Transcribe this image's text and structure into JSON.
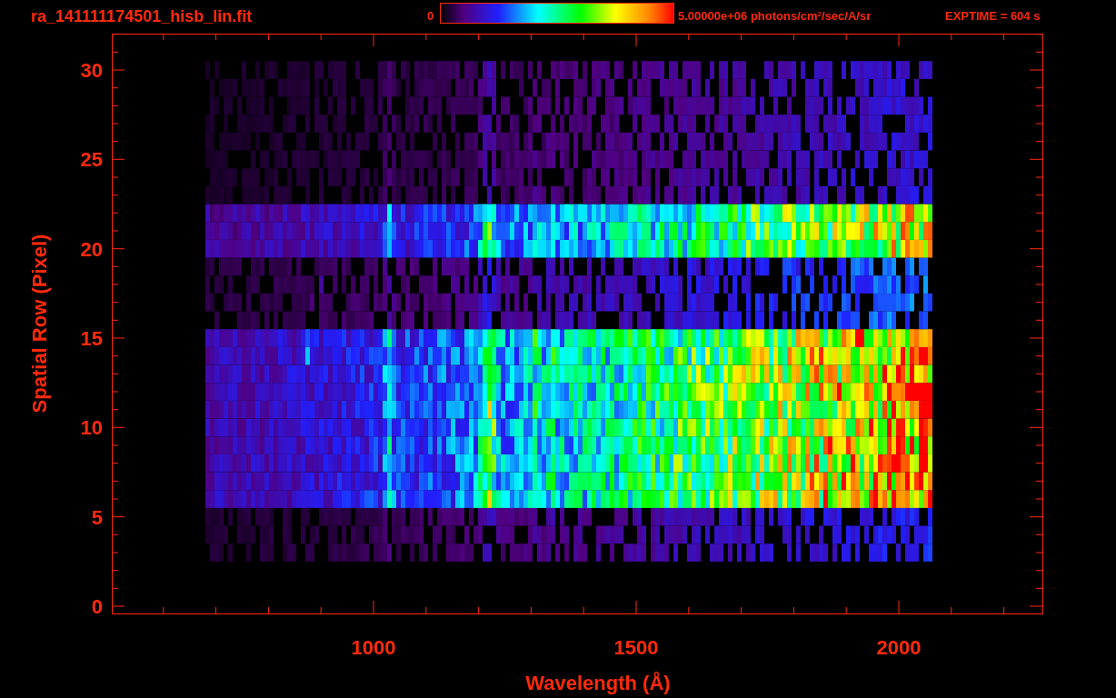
{
  "title": "ra_141111174501_hisb_lin.fit",
  "colorbar": {
    "min_label": "0",
    "max_label": "5.00000e+06 photons/cm$^{2}$/sec/A/sr"
  },
  "exposure": "EXPTIME = 604 s",
  "plot": {
    "xlabel": "Wavelength (Å)",
    "ylabel": "Spatial Row (Pixel)",
    "xticks": [
      "1000",
      "1500",
      "2000"
    ],
    "yticks": [
      "30",
      "25",
      "20",
      "15",
      "10",
      "5",
      "0"
    ]
  }
}
